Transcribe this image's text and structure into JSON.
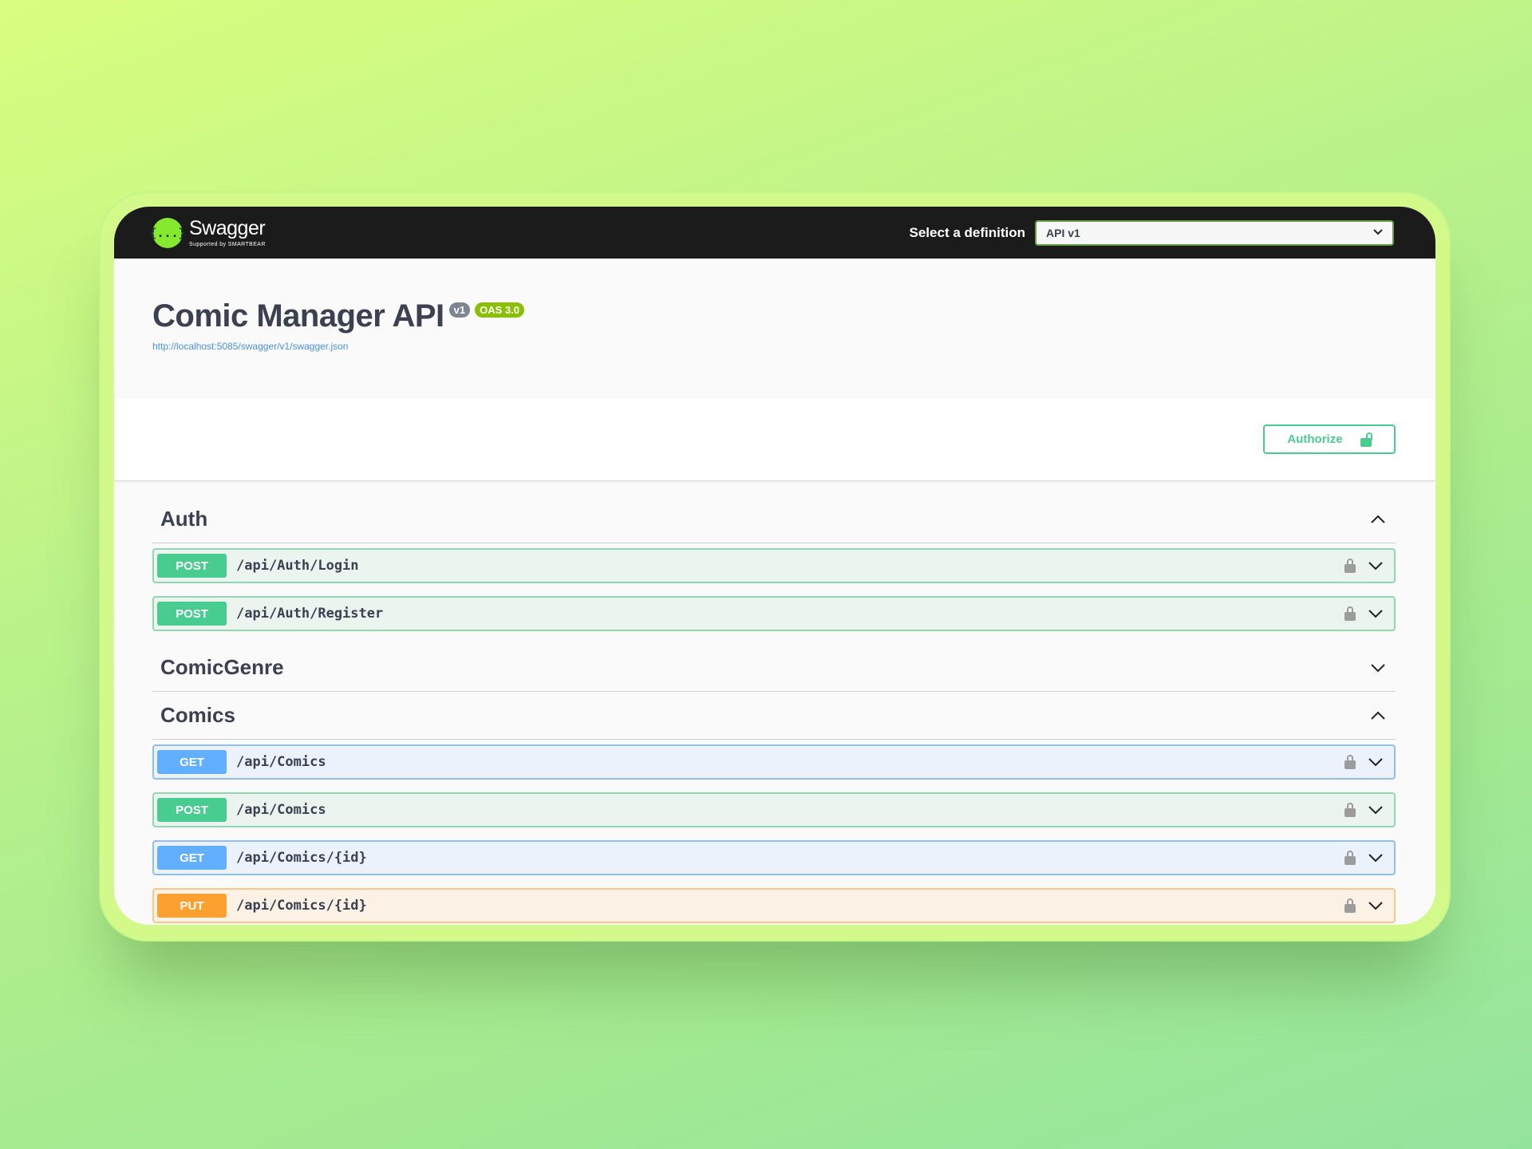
{
  "topbar": {
    "brand_name": "Swagger",
    "brand_sub": "Supported by SMARTBEAR",
    "logo_glyph": "{...}",
    "definition_label": "Select a definition",
    "definition_value": "API v1"
  },
  "info": {
    "title": "Comic Manager API",
    "version": "v1",
    "oas": "OAS 3.0",
    "spec_url": "http://localhost:5085/swagger/v1/swagger.json"
  },
  "authorize": {
    "label": "Authorize"
  },
  "tags": [
    {
      "name": "Auth",
      "expanded": true,
      "operations": [
        {
          "method": "POST",
          "path": "/api/Auth/Login"
        },
        {
          "method": "POST",
          "path": "/api/Auth/Register"
        }
      ]
    },
    {
      "name": "ComicGenre",
      "expanded": false,
      "operations": []
    },
    {
      "name": "Comics",
      "expanded": true,
      "operations": [
        {
          "method": "GET",
          "path": "/api/Comics"
        },
        {
          "method": "POST",
          "path": "/api/Comics"
        },
        {
          "method": "GET",
          "path": "/api/Comics/{id}"
        },
        {
          "method": "PUT",
          "path": "/api/Comics/{id}"
        }
      ]
    }
  ],
  "colors": {
    "post": "#49cc90",
    "get": "#61affe",
    "put": "#fca130",
    "topbar": "#1b1b1b",
    "brand": "#85ea2d",
    "oas_badge": "#89bf04",
    "version_badge": "#7d8492"
  },
  "icons": {
    "authorize": "unlocked-icon",
    "operation": "lock-icon",
    "collapse": "chevron-up-icon",
    "expand": "chevron-down-icon",
    "select": "chevron-down-icon"
  }
}
